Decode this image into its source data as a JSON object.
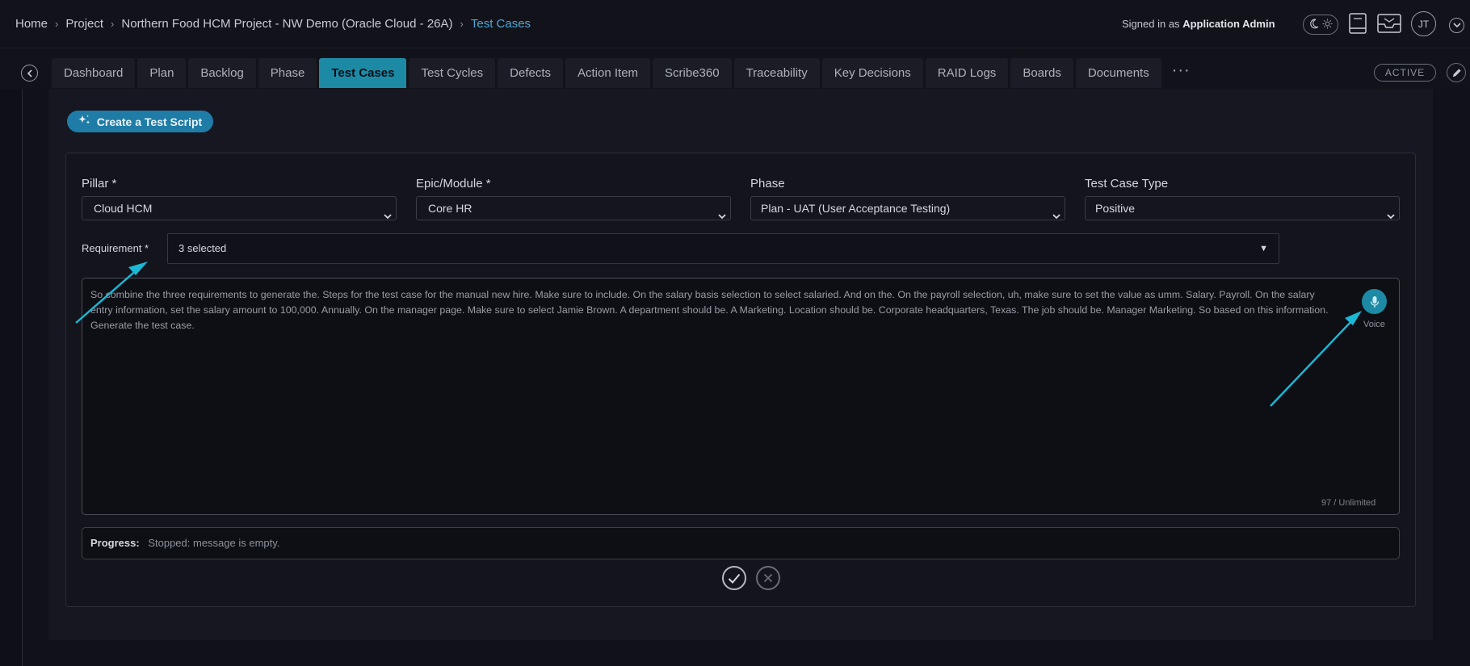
{
  "breadcrumb": {
    "items": [
      "Home",
      "Project",
      "Northern Food HCM Project - NW Demo (Oracle Cloud - 26A)"
    ],
    "current": "Test Cases"
  },
  "header": {
    "signed_in_prefix": "Signed in as",
    "signed_in_user": "Application Admin",
    "avatar_initials": "JT"
  },
  "tabs": [
    {
      "label": "Dashboard"
    },
    {
      "label": "Plan"
    },
    {
      "label": "Backlog"
    },
    {
      "label": "Phase"
    },
    {
      "label": "Test Cases",
      "active": true
    },
    {
      "label": "Test Cycles"
    },
    {
      "label": "Defects"
    },
    {
      "label": "Action Item"
    },
    {
      "label": "Scribe360"
    },
    {
      "label": "Traceability"
    },
    {
      "label": "Key Decisions"
    },
    {
      "label": "RAID Logs"
    },
    {
      "label": "Boards"
    },
    {
      "label": "Documents"
    }
  ],
  "more_tabs_label": "···",
  "status_badge": "ACTIVE",
  "create_button_label": "Create a Test Script",
  "form": {
    "pillar": {
      "label": "Pillar *",
      "value": "Cloud HCM"
    },
    "epic": {
      "label": "Epic/Module *",
      "value": "Core HR"
    },
    "phase": {
      "label": "Phase",
      "value": "Plan - UAT (User Acceptance Testing)"
    },
    "test_case_type": {
      "label": "Test Case Type",
      "value": "Positive"
    },
    "requirement": {
      "label": "Requirement *",
      "value": "3 selected"
    },
    "prompt_text": "So combine the three requirements to generate the. Steps for the test case for the manual new hire. Make sure to include. On the salary basis selection to select salaried. And on the. On the payroll selection, uh, make sure to set the value as umm. Salary. Payroll. On the salary entry information, set the salary amount to 100,000. Annually. On the manager page. Make sure to select Jamie Brown. A department should be. A Marketing. Location should be. Corporate headquarters, Texas. The job should be. Manager Marketing. So based on this information. Generate the test case.",
    "voice_label": "Voice",
    "char_counter": "97 / Unlimited",
    "progress_label": "Progress:",
    "progress_text": "Stopped: message is empty."
  },
  "colors": {
    "accent": "#1d8aa5",
    "link": "#4ea6d4",
    "annotation_arrow": "#1bb8d6",
    "background": "#0f1017"
  },
  "icons": [
    "chevron-right-icon",
    "moon-icon",
    "sun-icon",
    "book-icon",
    "inbox-icon",
    "chevron-down-icon",
    "chevron-left-icon",
    "more-icon",
    "pencil-icon",
    "sparkle-icon",
    "microphone-icon",
    "check-icon",
    "close-icon"
  ]
}
